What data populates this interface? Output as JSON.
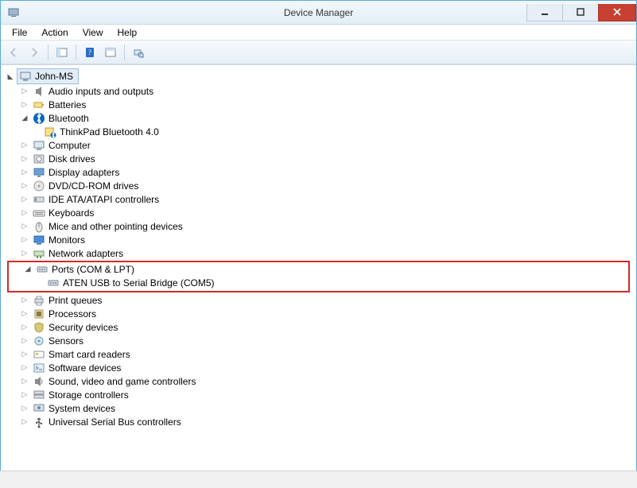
{
  "window": {
    "title": "Device Manager"
  },
  "menu": {
    "file": "File",
    "action": "Action",
    "view": "View",
    "help": "Help"
  },
  "root": {
    "name": "John-MS"
  },
  "categories": [
    {
      "label": "Audio inputs and outputs",
      "icon": "audio",
      "expanded": false,
      "children": []
    },
    {
      "label": "Batteries",
      "icon": "battery",
      "expanded": false,
      "children": []
    },
    {
      "label": "Bluetooth",
      "icon": "bluetooth",
      "expanded": true,
      "children": [
        {
          "label": "ThinkPad Bluetooth 4.0",
          "icon": "bluetooth-dev"
        }
      ]
    },
    {
      "label": "Computer",
      "icon": "computer",
      "expanded": false,
      "children": []
    },
    {
      "label": "Disk drives",
      "icon": "disk",
      "expanded": false,
      "children": []
    },
    {
      "label": "Display adapters",
      "icon": "display",
      "expanded": false,
      "children": []
    },
    {
      "label": "DVD/CD-ROM drives",
      "icon": "cdrom",
      "expanded": false,
      "children": []
    },
    {
      "label": "IDE ATA/ATAPI controllers",
      "icon": "ide",
      "expanded": false,
      "children": []
    },
    {
      "label": "Keyboards",
      "icon": "keyboard",
      "expanded": false,
      "children": []
    },
    {
      "label": "Mice and other pointing devices",
      "icon": "mouse",
      "expanded": false,
      "children": []
    },
    {
      "label": "Monitors",
      "icon": "monitor",
      "expanded": false,
      "children": []
    },
    {
      "label": "Network adapters",
      "icon": "network",
      "expanded": false,
      "children": []
    },
    {
      "label": "Ports (COM & LPT)",
      "icon": "port",
      "expanded": true,
      "highlight": true,
      "children": [
        {
          "label": "ATEN USB to Serial Bridge (COM5)",
          "icon": "port"
        }
      ]
    },
    {
      "label": "Print queues",
      "icon": "printer",
      "expanded": false,
      "children": []
    },
    {
      "label": "Processors",
      "icon": "cpu",
      "expanded": false,
      "children": []
    },
    {
      "label": "Security devices",
      "icon": "security",
      "expanded": false,
      "children": []
    },
    {
      "label": "Sensors",
      "icon": "sensor",
      "expanded": false,
      "children": []
    },
    {
      "label": "Smart card readers",
      "icon": "smartcard",
      "expanded": false,
      "children": []
    },
    {
      "label": "Software devices",
      "icon": "software",
      "expanded": false,
      "children": []
    },
    {
      "label": "Sound, video and game controllers",
      "icon": "sound",
      "expanded": false,
      "children": []
    },
    {
      "label": "Storage controllers",
      "icon": "storage",
      "expanded": false,
      "children": []
    },
    {
      "label": "System devices",
      "icon": "system",
      "expanded": false,
      "children": []
    },
    {
      "label": "Universal Serial Bus controllers",
      "icon": "usb",
      "expanded": false,
      "children": []
    }
  ]
}
